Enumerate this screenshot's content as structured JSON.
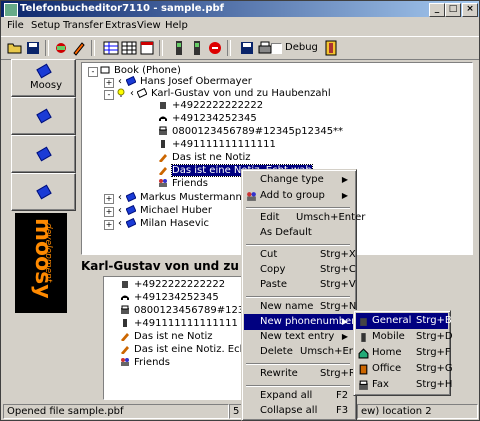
{
  "window": {
    "title": "Telefonbucheditor7110 - sample.pbf",
    "minimize": "_",
    "maximize": "□",
    "close": "×"
  },
  "menubar": [
    "File",
    "Setup",
    "Transfer",
    "Extras",
    "View",
    "Help"
  ],
  "toolbar": {
    "debug_label": "Debug"
  },
  "sidebar": {
    "items": [
      {
        "label": "Moosy"
      },
      {
        "label": ""
      },
      {
        "label": ""
      },
      {
        "label": ""
      }
    ],
    "logo_text": "moosy",
    "logo_sub": "development"
  },
  "tree": {
    "root": "Book (Phone)",
    "contacts": [
      {
        "name": "Hans Josef Obermayer",
        "expand": "+"
      },
      {
        "name": "Karl-Gustav von und zu Haubenzahl",
        "expand": "-"
      }
    ],
    "entries": [
      "+4922222222222",
      "+491234252345",
      "0800123456789#12345p12345**",
      "+491111111111111",
      "Das ist ne Notiz",
      "Das ist eine Notiz. Echt wah",
      "Friends"
    ],
    "more_contacts": [
      {
        "name": "Markus Mustermann",
        "expand": "+"
      },
      {
        "name": "Michael Huber",
        "expand": "+"
      },
      {
        "name": "Milan Hasevic",
        "expand": "+"
      }
    ]
  },
  "detail": {
    "heading": "Karl-Gustav von und zu Haubenzahl",
    "items": [
      "+4922222222222",
      "+491234252345",
      "0800123456789#12345p12345**",
      "+491111111111111",
      "Das ist ne Notiz",
      "Das ist eine Notiz. Echt wah",
      "Friends"
    ]
  },
  "context_menu": {
    "items": [
      {
        "label": "Change type",
        "shortcut": "",
        "submenu": true
      },
      {
        "label": "Add to group",
        "shortcut": "",
        "submenu": true
      },
      {
        "label": "Edit",
        "shortcut": "Umsch+Enter"
      },
      {
        "label": "As Default",
        "shortcut": ""
      },
      {
        "label": "Cut",
        "shortcut": "Strg+X"
      },
      {
        "label": "Copy",
        "shortcut": "Strg+C"
      },
      {
        "label": "Paste",
        "shortcut": "Strg+V"
      },
      {
        "label": "New name",
        "shortcut": "Strg+N"
      },
      {
        "label": "New phonenumber",
        "shortcut": "",
        "submenu": true,
        "highlighted": true
      },
      {
        "label": "New text entry",
        "shortcut": "",
        "submenu": true
      },
      {
        "label": "Delete",
        "shortcut": "Umsch+Entf"
      },
      {
        "label": "Rewrite",
        "shortcut": "Strg+R"
      },
      {
        "label": "Expand all",
        "shortcut": "F2"
      },
      {
        "label": "Collapse all",
        "shortcut": "F3"
      }
    ]
  },
  "submenu": {
    "items": [
      {
        "label": "General",
        "shortcut": "Strg+B",
        "highlighted": true
      },
      {
        "label": "Mobile",
        "shortcut": "Strg+D"
      },
      {
        "label": "Home",
        "shortcut": "Strg+F"
      },
      {
        "label": "Office",
        "shortcut": "Strg+G"
      },
      {
        "label": "Fax",
        "shortcut": "Strg+H"
      }
    ]
  },
  "status": {
    "left": "Opened file sample.pbf",
    "mid": "5",
    "right": "ew) location 2"
  }
}
